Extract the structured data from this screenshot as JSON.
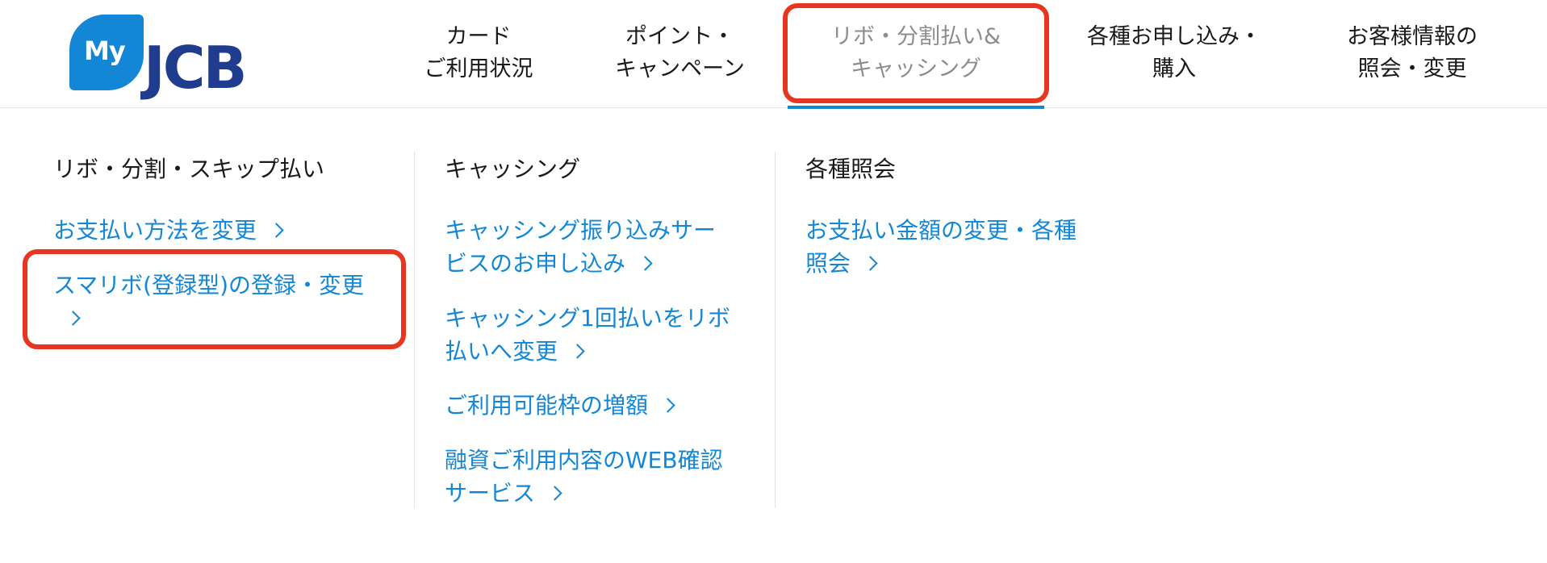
{
  "logo": {
    "my": "My",
    "brand": "JCB"
  },
  "nav": [
    {
      "line1": "カード",
      "line2": "ご利用状況"
    },
    {
      "line1": "ポイント・",
      "line2": "キャンペーン"
    },
    {
      "line1": "リボ・分割払い&",
      "line2": "キャッシング"
    },
    {
      "line1": "各種お申し込み・",
      "line2": "購入"
    },
    {
      "line1": "お客様情報の",
      "line2": "照会・変更"
    }
  ],
  "active_nav_index": 2,
  "columns": {
    "ribo": {
      "title": "リボ・分割・スキップ払い",
      "links": [
        {
          "lines": [
            "お支払い方法を変更"
          ]
        },
        {
          "lines": [
            "スマリボ(登録型)の登録・変更",
            ""
          ]
        }
      ]
    },
    "cashing": {
      "title": "キャッシング",
      "links": [
        {
          "lines": [
            "キャッシング振り込みサー",
            "ビスのお申し込み"
          ]
        },
        {
          "lines": [
            "キャッシング1回払いをリボ",
            "払いへ変更"
          ]
        },
        {
          "lines": [
            "ご利用可能枠の増額"
          ]
        },
        {
          "lines": [
            "融資ご利用内容のWEB確認",
            "サービス"
          ]
        }
      ]
    },
    "inquiry": {
      "title": "各種照会",
      "links": [
        {
          "lines": [
            "お支払い金額の変更・各種",
            "照会"
          ]
        }
      ]
    }
  },
  "colors": {
    "link": "#1387d6",
    "highlight": "#e8351f",
    "brand_blue": "#1f3c8f",
    "leaf_blue": "#1387d6"
  }
}
